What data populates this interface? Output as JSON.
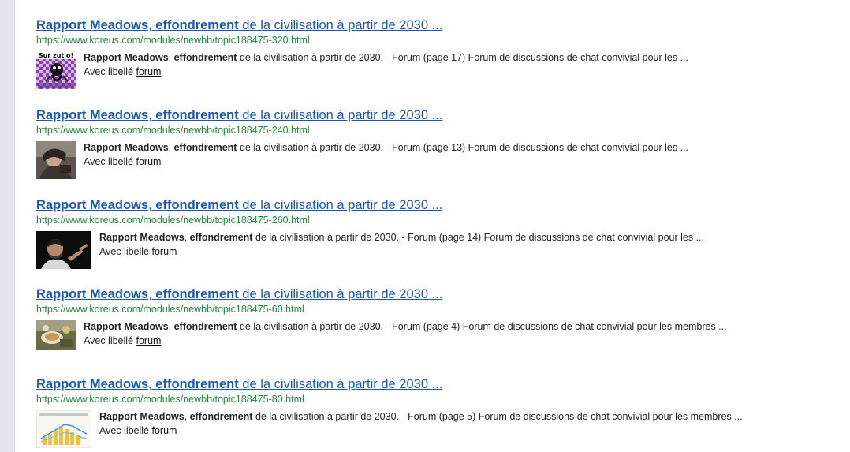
{
  "results": [
    {
      "title_bold_1": "Rapport Meadows",
      "title_sep": ", ",
      "title_bold_2": "effondrement",
      "title_rest": " de la civilisation à partir de 2030 ...",
      "url": "https://www.koreus.com/modules/newbb/topic188475-320.html",
      "snippet_bold_1": "Rapport Meadows",
      "snippet_sep": ", ",
      "snippet_bold_2": "effondrement",
      "snippet_rest": " de la civilisation à partir de 2030. - Forum (page 17) Forum de discussions de chat convivial pour les ...",
      "tag_prefix": "Avec libellé ",
      "tag_link": "forum",
      "thumb_text": "Sur zut o!",
      "thumb_icon": "cartoon-character-icon"
    },
    {
      "title_bold_1": "Rapport Meadows",
      "title_sep": ", ",
      "title_bold_2": "effondrement",
      "title_rest": " de la civilisation à partir de 2030 ...",
      "url": "https://www.koreus.com/modules/newbb/topic188475-240.html",
      "snippet_bold_1": "Rapport Meadows",
      "snippet_sep": ", ",
      "snippet_bold_2": "effondrement",
      "snippet_rest": " de la civilisation à partir de 2030. - Forum (page 13) Forum de discussions de chat convivial pour les ...",
      "tag_prefix": "Avec libellé ",
      "tag_link": "forum",
      "thumb_icon": "person-photo-icon"
    },
    {
      "title_bold_1": "Rapport Meadows",
      "title_sep": ", ",
      "title_bold_2": "effondrement",
      "title_rest": " de la civilisation à partir de 2030 ...",
      "url": "https://www.koreus.com/modules/newbb/topic188475-260.html",
      "snippet_bold_1": "Rapport Meadows",
      "snippet_sep": ", ",
      "snippet_bold_2": "effondrement",
      "snippet_rest": " de la civilisation à partir de 2030. - Forum (page 14) Forum de discussions de chat convivial pour les ...",
      "tag_prefix": "Avec libellé ",
      "tag_link": "forum",
      "thumb_icon": "man-pointing-photo-icon"
    },
    {
      "title_bold_1": "Rapport Meadows",
      "title_sep": ", ",
      "title_bold_2": "effondrement",
      "title_rest": " de la civilisation à partir de 2030 ...",
      "url": "https://www.koreus.com/modules/newbb/topic188475-60.html",
      "snippet_bold_1": "Rapport Meadows",
      "snippet_sep": ", ",
      "snippet_bold_2": "effondrement",
      "snippet_rest": " de la civilisation à partir de 2030. - Forum (page 4) Forum de discussions de chat convivial pour les membres ...",
      "tag_prefix": "Avec libellé ",
      "tag_link": "forum",
      "thumb_icon": "food-table-photo-icon"
    },
    {
      "title_bold_1": "Rapport Meadows",
      "title_sep": ", ",
      "title_bold_2": "effondrement",
      "title_rest": " de la civilisation à partir de 2030 ...",
      "url": "https://www.koreus.com/modules/newbb/topic188475-80.html",
      "snippet_bold_1": "Rapport Meadows",
      "snippet_sep": ", ",
      "snippet_bold_2": "effondrement",
      "snippet_rest": " de la civilisation à partir de 2030. - Forum (page 5) Forum de discussions de chat convivial pour les membres ...",
      "tag_prefix": "Avec libellé ",
      "tag_link": "forum",
      "thumb_icon": "chart-thumbnail-icon"
    }
  ],
  "colors": {
    "title_link": "#1a56b8",
    "url_green": "#1e8c3a",
    "snippet_text": "#222222",
    "left_rail": "#e6e4ee"
  }
}
